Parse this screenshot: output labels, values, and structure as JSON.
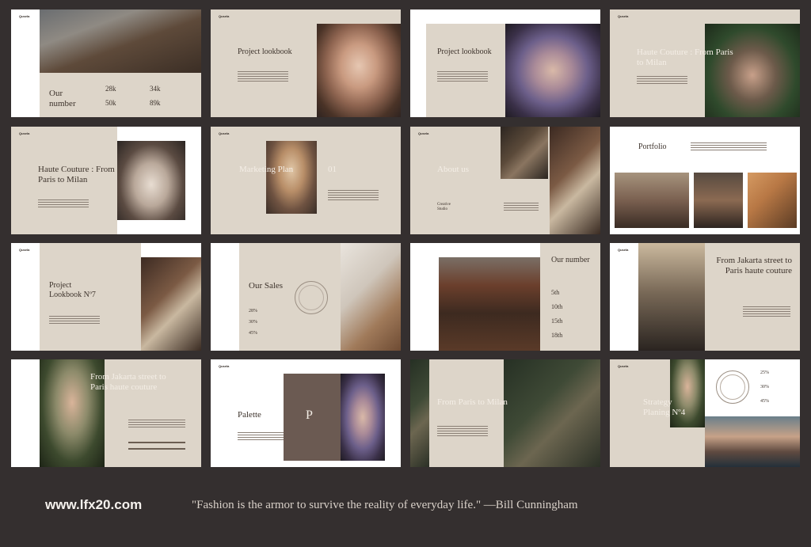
{
  "brand": "Qusela",
  "slides": {
    "s1": {
      "title": "Our number",
      "stats": [
        "28k",
        "34k",
        "50k",
        "89k"
      ]
    },
    "s2": {
      "title": "Project lookbook"
    },
    "s3": {
      "title": "Project lookbook"
    },
    "s4": {
      "title": "Haute Couture : From Paris to Milan"
    },
    "s5": {
      "title": "Haute Couture : From Paris to Milan"
    },
    "s6": {
      "title": "Marketing Plan",
      "number": "01"
    },
    "s7": {
      "title": "About us",
      "subtitle": "Creative Studio"
    },
    "s8": {
      "title": "Portfolio"
    },
    "s9": {
      "title": "Project Lookbook Nº7"
    },
    "s10": {
      "title": "Our Sales",
      "stats": [
        "28%",
        "30%",
        "45%"
      ]
    },
    "s11": {
      "title": "Our number",
      "stats": [
        "5th",
        "10th",
        "15th",
        "18th"
      ]
    },
    "s12": {
      "title": "From Jakarta street to Paris haute couture"
    },
    "s13": {
      "title": "From Jakarta street to Paris haute couture"
    },
    "s14": {
      "title": "Palette",
      "letter": "P"
    },
    "s15": {
      "title": "From Paris to Milan"
    },
    "s16": {
      "title": "Strategy Planing Nº4",
      "stats": [
        "25%",
        "30%",
        "45%"
      ]
    }
  },
  "footer": {
    "url": "www.lfx20.com",
    "quote": "\"Fashion is the armor to survive the reality of everyday life.\" —Bill Cunningham"
  }
}
